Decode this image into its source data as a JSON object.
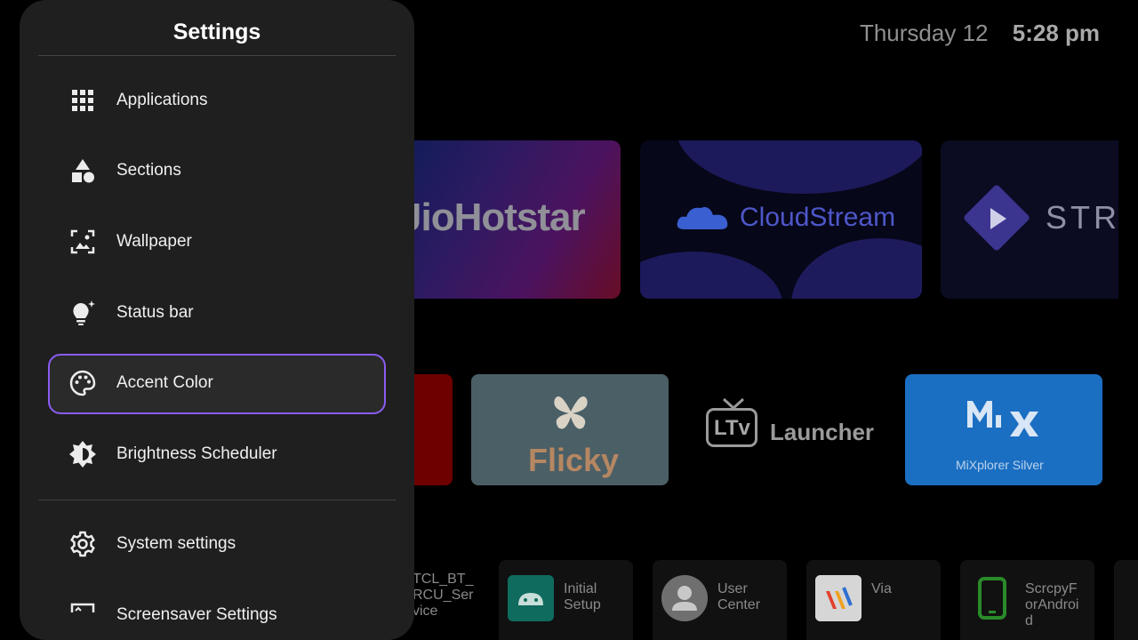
{
  "clock": {
    "day": "Thursday 12",
    "time": "5:28 pm"
  },
  "banners": [
    {
      "label": "JioHotstar"
    },
    {
      "label": "CloudStream"
    },
    {
      "label": "STRE"
    }
  ],
  "tiles": [
    {
      "label": ""
    },
    {
      "label": "Flicky"
    },
    {
      "label": "Launcher",
      "badge": "LTv"
    },
    {
      "label": "MiXplorer Silver"
    }
  ],
  "apps": [
    {
      "label": "TCL_BT_\nRCU_Ser\nvice"
    },
    {
      "label": "Initial\nSetup"
    },
    {
      "label": "User\nCenter"
    },
    {
      "label": "Via"
    },
    {
      "label": "ScrcpyF\norAndroi\nd"
    }
  ],
  "settings": {
    "title": "Settings",
    "items": [
      {
        "label": "Applications",
        "icon": "apps-grid-icon"
      },
      {
        "label": "Sections",
        "icon": "shapes-icon"
      },
      {
        "label": "Wallpaper",
        "icon": "wallpaper-icon"
      },
      {
        "label": "Status bar",
        "icon": "lightbulb-icon"
      },
      {
        "label": "Accent Color",
        "icon": "palette-icon",
        "selected": true
      },
      {
        "label": "Brightness Scheduler",
        "icon": "brightness-icon"
      },
      {
        "label": "System settings",
        "icon": "gear-icon"
      },
      {
        "label": "Screensaver Settings",
        "icon": "screensaver-icon"
      }
    ]
  },
  "colors": {
    "accent": "#8a5cf0",
    "panel": "#1f1f1f",
    "background": "#000000"
  }
}
